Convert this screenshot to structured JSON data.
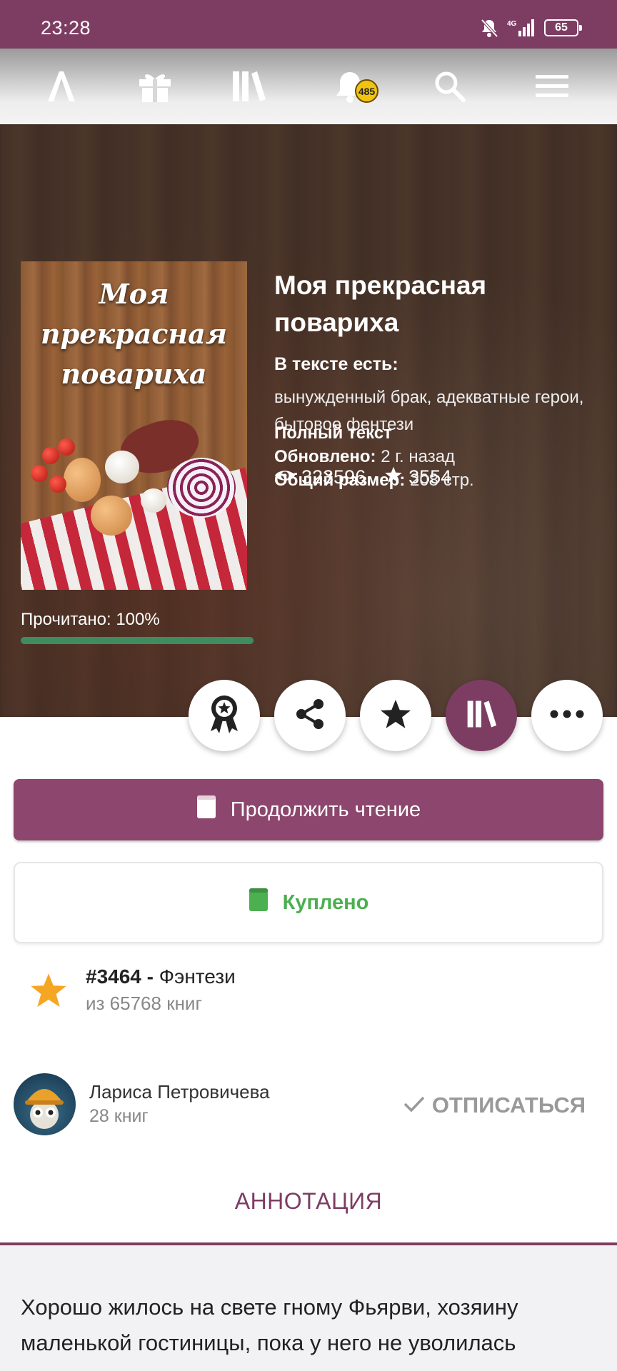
{
  "status_bar": {
    "time": "23:28",
    "signal": "4G",
    "battery": "65"
  },
  "top_nav": {
    "items": [
      "logo-icon",
      "gift-icon",
      "library-icon",
      "bell-icon",
      "search-icon",
      "menu-icon"
    ],
    "notifications_count": "485"
  },
  "book": {
    "cover_title": "Моя прекрасная повариха",
    "title": "Моя прекрасная повариха",
    "tags_label": "В тексте есть:",
    "tags": "вынужденный брак, адекватные герои, бытовое фентези",
    "views": "323596",
    "likes": "3554",
    "status": "Полный текст",
    "updated_label": "Обновлено:",
    "updated_value": "2 г. назад",
    "size_label": "Общий размер:",
    "size_value": "208 стр.",
    "progress_label": "Прочитано: 100%",
    "progress": 1.0
  },
  "actions": [
    "award-icon",
    "share-icon",
    "star-icon",
    "library-icon",
    "more-icon"
  ],
  "buttons": {
    "continue": "Продолжить чтение",
    "bought": "Куплено"
  },
  "rating": {
    "rank": "#3464 -",
    "genre": "Фэнтези",
    "of": "из 65768 книг"
  },
  "author": {
    "name": "Лариса Петровичева",
    "books": "28 книг",
    "unsubscribe": "ОТПИСАТЬСЯ"
  },
  "annotation": {
    "tab": "АННОТАЦИЯ",
    "text": "Хорошо жилось на свете гному Фьярви, хозяину маленькой гостиницы, пока у него не уволилась"
  },
  "colors": {
    "primary": "#7d3d63",
    "button": "#8d466d",
    "green": "#4caf50",
    "progress": "#3e8c5f",
    "star": "#f5a623"
  }
}
